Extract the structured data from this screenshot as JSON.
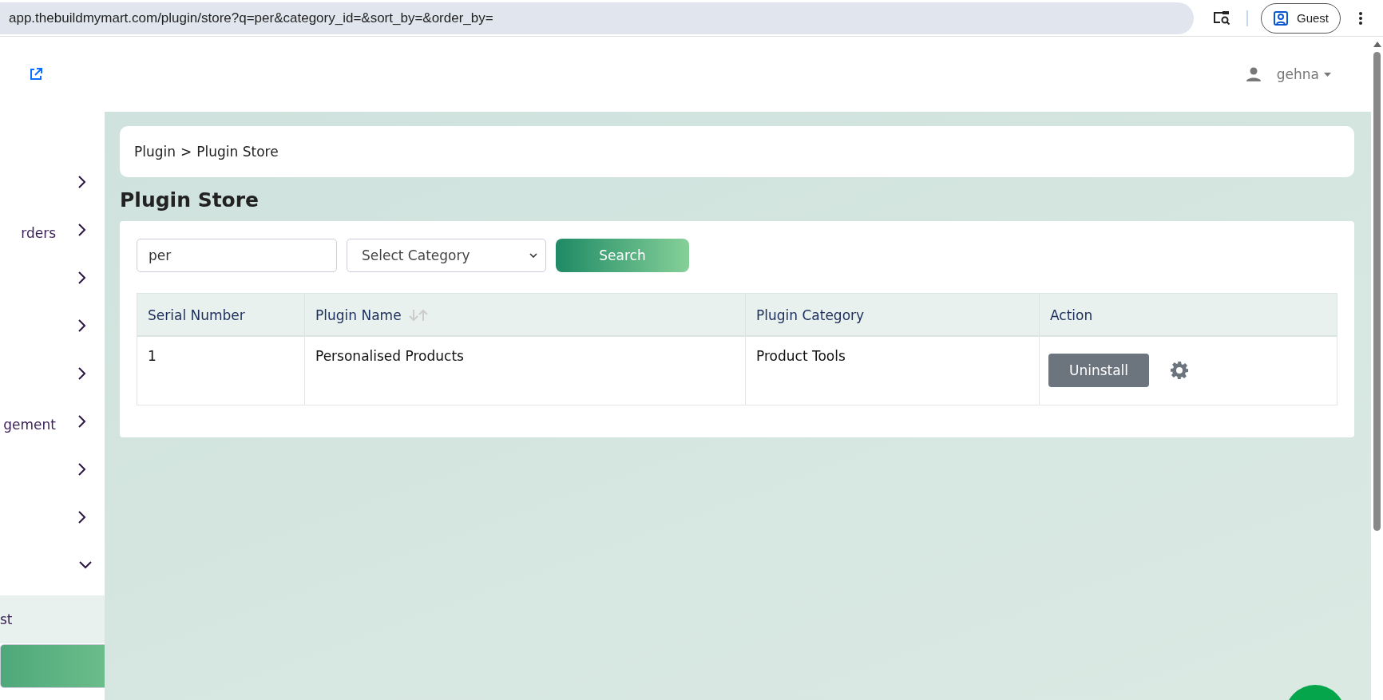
{
  "browser": {
    "url": "app.thebuildmymart.com/plugin/store?q=per&category_id=&sort_by=&order_by=",
    "profile": "Guest"
  },
  "header": {
    "user": "gehna"
  },
  "sidebar": {
    "items": [
      {
        "expanded": false
      },
      {
        "label": "rders",
        "expanded": false
      },
      {
        "expanded": false
      },
      {
        "expanded": false
      },
      {
        "expanded": false
      },
      {
        "label": "gement",
        "expanded": false
      },
      {
        "expanded": false
      },
      {
        "expanded": false
      },
      {
        "expanded": true,
        "children": [
          {
            "label": "st",
            "highlighted": true,
            "selected": false
          },
          {
            "highlighted": false,
            "selected": true
          }
        ]
      }
    ]
  },
  "breadcrumb": {
    "items": [
      "Plugin",
      "Plugin Store"
    ],
    "separator": ">"
  },
  "page_title": "Plugin Store",
  "filters": {
    "search_value": "per",
    "category_placeholder": "Select Category",
    "button": "Search"
  },
  "table": {
    "columns": [
      {
        "label": "Serial Number",
        "sortable": false
      },
      {
        "label": "Plugin Name",
        "sortable": true
      },
      {
        "label": "Plugin Category",
        "sortable": false
      },
      {
        "label": "Action",
        "sortable": false
      }
    ],
    "rows": [
      {
        "cells": [
          "1",
          "Personalised Products",
          "Product Tools"
        ],
        "action": "Uninstall"
      }
    ]
  }
}
